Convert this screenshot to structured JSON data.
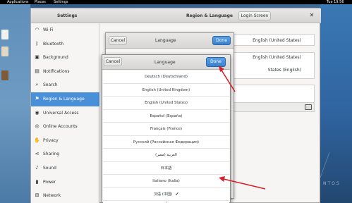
{
  "topbar": {
    "applications": "Applications",
    "places": "Places",
    "settings": "Settings",
    "clock": "Tue 19:56"
  },
  "window": {
    "app_title": "Settings",
    "page_title": "Region & Language",
    "login_screen_label": "Login Screen"
  },
  "sidebar": {
    "items": [
      {
        "label": "Wi-Fi",
        "icon": "wifi-icon"
      },
      {
        "label": "Bluetooth",
        "icon": "bluetooth-icon"
      },
      {
        "label": "Background",
        "icon": "background-icon"
      },
      {
        "label": "Notifications",
        "icon": "bell-icon"
      },
      {
        "label": "Search",
        "icon": "search-icon"
      },
      {
        "label": "Region & Language",
        "icon": "flag-icon"
      },
      {
        "label": "Universal Access",
        "icon": "accessibility-icon"
      },
      {
        "label": "Online Accounts",
        "icon": "account-icon"
      },
      {
        "label": "Privacy",
        "icon": "privacy-icon"
      },
      {
        "label": "Sharing",
        "icon": "share-icon"
      },
      {
        "label": "Sound",
        "icon": "speaker-icon"
      },
      {
        "label": "Power",
        "icon": "power-icon"
      },
      {
        "label": "Network",
        "icon": "network-icon"
      }
    ],
    "active_index": 5
  },
  "content": {
    "language_value": "English (United States)",
    "formats_value": "English (United States)",
    "formats_value_2": "States (English)"
  },
  "back_dialog": {
    "title": "Language",
    "cancel_label": "Cancel",
    "done_label": "Done"
  },
  "dialog": {
    "title": "Language",
    "cancel_label": "Cancel",
    "done_label": "Done",
    "languages": [
      "Deutsch (Deutschland)",
      "English (United Kingdom)",
      "English (United States)",
      "Español (España)",
      "Français (France)",
      "Русский (Российская Федерация)",
      "العربية (مصر)",
      "日本語",
      "Italiano (Italia)",
      "汉语 (中国)"
    ],
    "selected_language": "汉语 (中国)",
    "more_label": "⋮"
  },
  "desktop": {
    "brand": "NTOS"
  },
  "colors": {
    "accent": "#4a90d9",
    "arrow": "#d8202a"
  }
}
